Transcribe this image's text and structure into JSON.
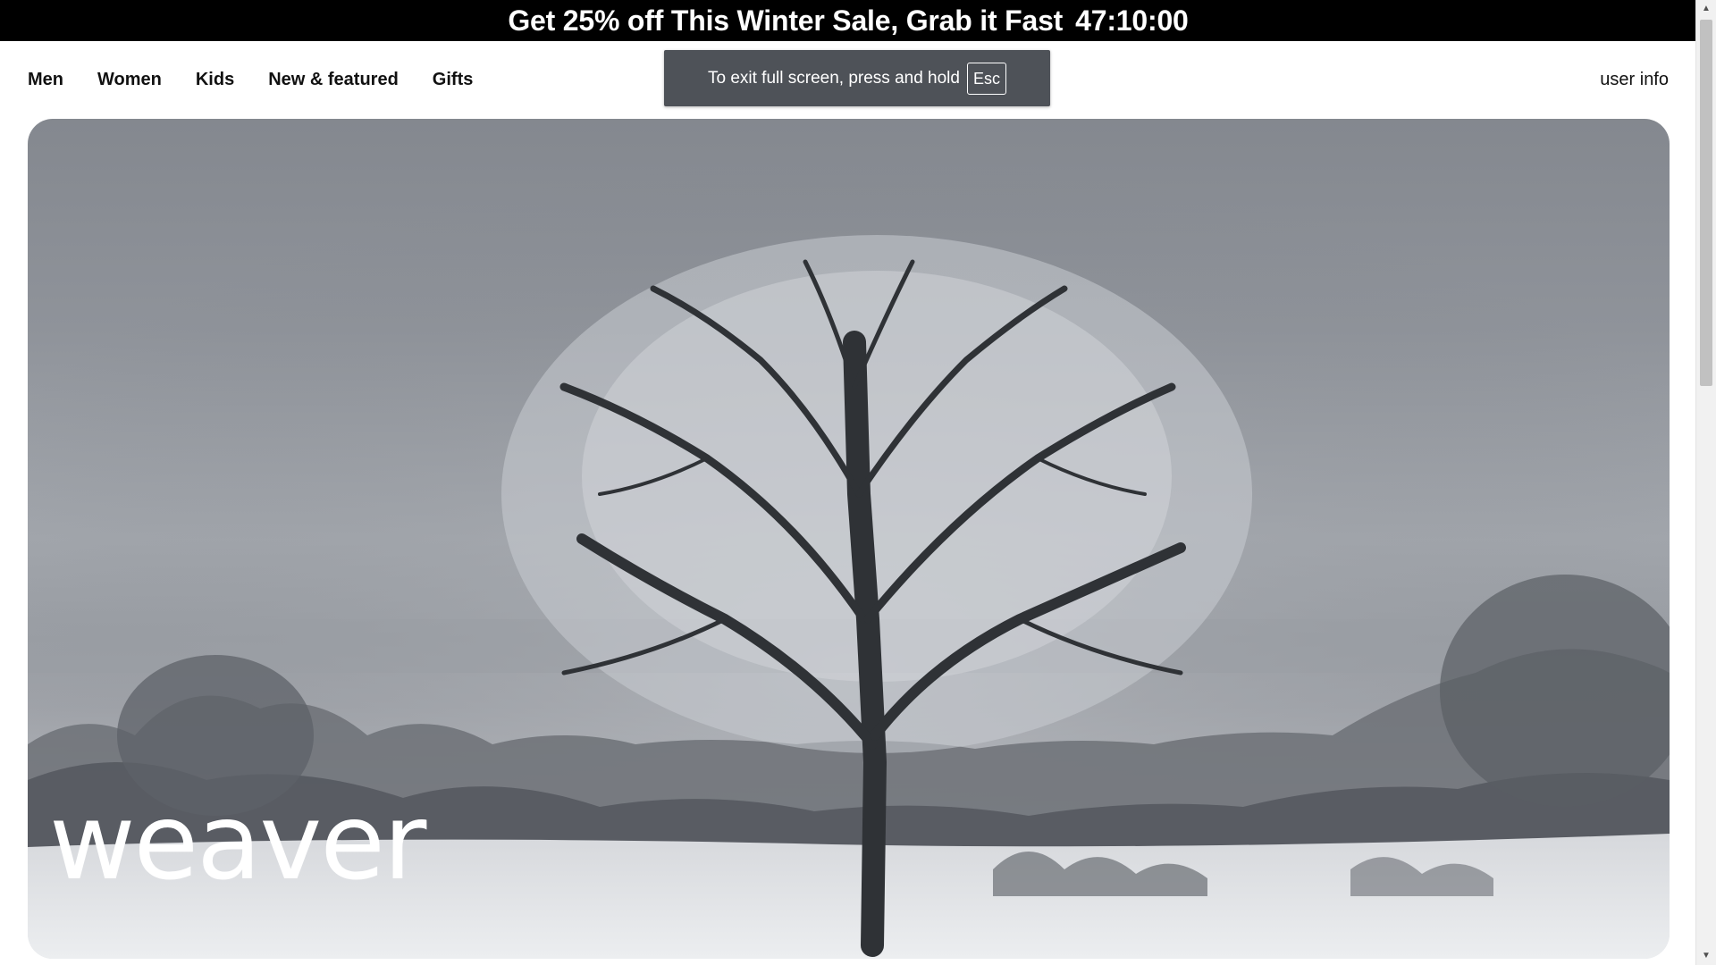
{
  "promo": {
    "text": "Get 25% off This Winter Sale, Grab it Fast",
    "timer": "47:10:00"
  },
  "nav": {
    "items": [
      {
        "label": "Men"
      },
      {
        "label": "Women"
      },
      {
        "label": "Kids"
      },
      {
        "label": "New & featured"
      },
      {
        "label": "Gifts"
      }
    ],
    "user_info": "user info"
  },
  "fullscreen_toast": {
    "message": "To exit full screen, press and hold",
    "key": "Esc"
  },
  "hero": {
    "brand": "weaver",
    "image": "frosted-tree-winter-landscape"
  },
  "colors": {
    "promo_bg": "#000000",
    "promo_text": "#ffffff",
    "toast_bg": "#4e5258"
  },
  "scrollbar": {
    "up_icon": "chevron-up-icon",
    "down_icon": "chevron-down-icon"
  }
}
